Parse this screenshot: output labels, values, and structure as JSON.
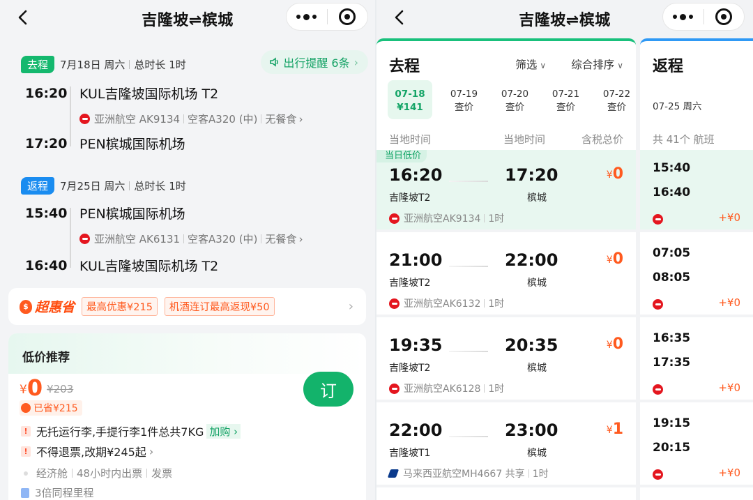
{
  "left": {
    "nav_title": "吉隆坡⇌槟城",
    "outbound": {
      "tag": "去程",
      "date": "7月18日 周六",
      "duration": "总时长 1时",
      "remind": "出行提醒 6条",
      "dep_time": "16:20",
      "dep_airport": "KUL吉隆坡国际机场 T2",
      "airline": "亚洲航空 AK9134",
      "aircraft": "空客A320 (中)",
      "meal": "无餐食",
      "arr_time": "17:20",
      "arr_airport": "PEN槟城国际机场"
    },
    "return": {
      "tag": "返程",
      "date": "7月25日 周六",
      "duration": "总时长 1时",
      "dep_time": "15:40",
      "dep_airport": "PEN槟城国际机场",
      "airline": "亚洲航空 AK6131",
      "aircraft": "空客A320 (中)",
      "meal": "无餐食",
      "arr_time": "16:40",
      "arr_airport": "KUL吉隆坡国际机场 T2"
    },
    "promo": {
      "brand": "超惠省",
      "chip1": "最高优惠¥215",
      "chip2": "机酒连订最高返现¥50"
    },
    "recommend": {
      "title": "低价推荐",
      "currency": "¥",
      "price": "0",
      "old_price": "¥203",
      "saved": "已省¥215",
      "book": "订",
      "rule1": "无托运行李,手提行李1件总共7KG",
      "rule1_link": "加购",
      "rule2": "不得退票,改期¥245起",
      "cabin": "经济舱",
      "ticketing": "48小时内出票",
      "invoice": "发票",
      "miles": "3倍同程里程"
    }
  },
  "right": {
    "nav_title": "吉隆坡⇌槟城",
    "outbound_head": "去程",
    "filter": "筛选",
    "sort": "综合排序",
    "dates": [
      {
        "d": "07-18",
        "p": "¥141"
      },
      {
        "d": "07-19",
        "p": "查价"
      },
      {
        "d": "07-20",
        "p": "查价"
      },
      {
        "d": "07-21",
        "p": "查价"
      },
      {
        "d": "07-22",
        "p": "查价"
      }
    ],
    "col_dep": "当地时间",
    "col_arr": "当地时间",
    "col_price": "含税总价",
    "low_tag": "当日低价",
    "flights": [
      {
        "dep": "16:20",
        "arr": "17:20",
        "from": "吉隆坡T2",
        "to": "槟城",
        "price": "0",
        "airline": "亚洲航空AK9134",
        "dur": "1时"
      },
      {
        "dep": "21:00",
        "arr": "22:00",
        "from": "吉隆坡T2",
        "to": "槟城",
        "price": "0",
        "airline": "亚洲航空AK6132",
        "dur": "1时"
      },
      {
        "dep": "19:35",
        "arr": "20:35",
        "from": "吉隆坡T2",
        "to": "槟城",
        "price": "0",
        "airline": "亚洲航空AK6128",
        "dur": "1时"
      },
      {
        "dep": "22:00",
        "arr": "23:00",
        "from": "吉隆坡T1",
        "to": "槟城",
        "price": "1",
        "airline": "马来西亚航空MH4667 共享",
        "dur": "1时"
      }
    ],
    "return_head": "返程",
    "return_date": "07-25 周六",
    "return_count": "共 41个 航班",
    "returns": [
      {
        "dep": "15:40",
        "arr": "16:40",
        "price": "+¥0"
      },
      {
        "dep": "07:05",
        "arr": "08:05",
        "price": "+¥0"
      },
      {
        "dep": "16:35",
        "arr": "17:35",
        "price": "+¥0"
      },
      {
        "dep": "19:15",
        "arr": "20:15",
        "price": "+¥0"
      }
    ]
  }
}
